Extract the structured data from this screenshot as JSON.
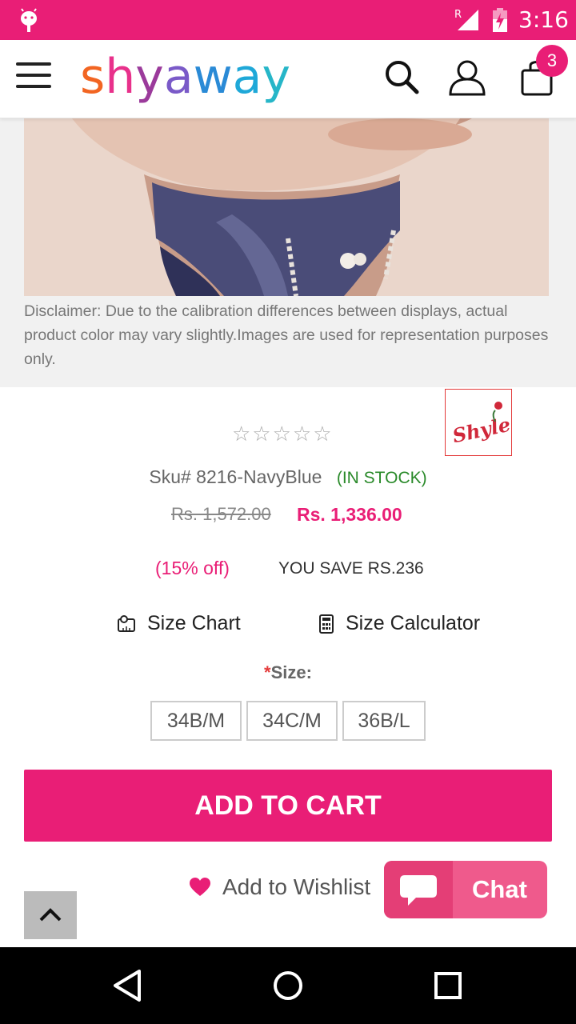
{
  "status_bar": {
    "time": "3:16",
    "roaming": "R",
    "icons": [
      "android-icon",
      "signal-icon",
      "battery-charging-icon"
    ]
  },
  "header": {
    "logo_letters": [
      "s",
      "h",
      "y",
      "a",
      "w",
      "a",
      "y"
    ],
    "logo_colors": [
      "#f26522",
      "#e8318b",
      "#9b3a9b",
      "#7a5ac8",
      "#2a8ad6",
      "#1fa8d8",
      "#26b6c8"
    ],
    "cart_count": "3",
    "icons": [
      "menu-icon",
      "search-icon",
      "user-icon",
      "shopping-bag-icon"
    ]
  },
  "product": {
    "disclaimer": "Disclaimer: Due to the calibration differences between displays, actual product color may vary slightly.Images are used for representation purposes only.",
    "brand_logo": "Shyle",
    "rating_stars": "☆☆☆☆☆",
    "sku": "Sku# 8216-NavyBlue",
    "stock": "(IN STOCK)",
    "price_old": "Rs. 1,572.00",
    "price_new": "Rs. 1,336.00",
    "discount": "(15% off)",
    "you_save": "YOU SAVE RS.236",
    "size_chart": "Size Chart",
    "size_calculator": "Size Calculator",
    "size_required_mark": "*",
    "size_label": "Size:",
    "sizes": [
      "34B/M",
      "34C/M",
      "36B/L"
    ]
  },
  "actions": {
    "add_to_cart": "ADD TO CART",
    "wishlist": "Add to Wishlist",
    "chat": "Chat"
  },
  "colors": {
    "accent": "#e91e76",
    "stock": "#2a8a2a",
    "chat": "#ef5a8c"
  }
}
